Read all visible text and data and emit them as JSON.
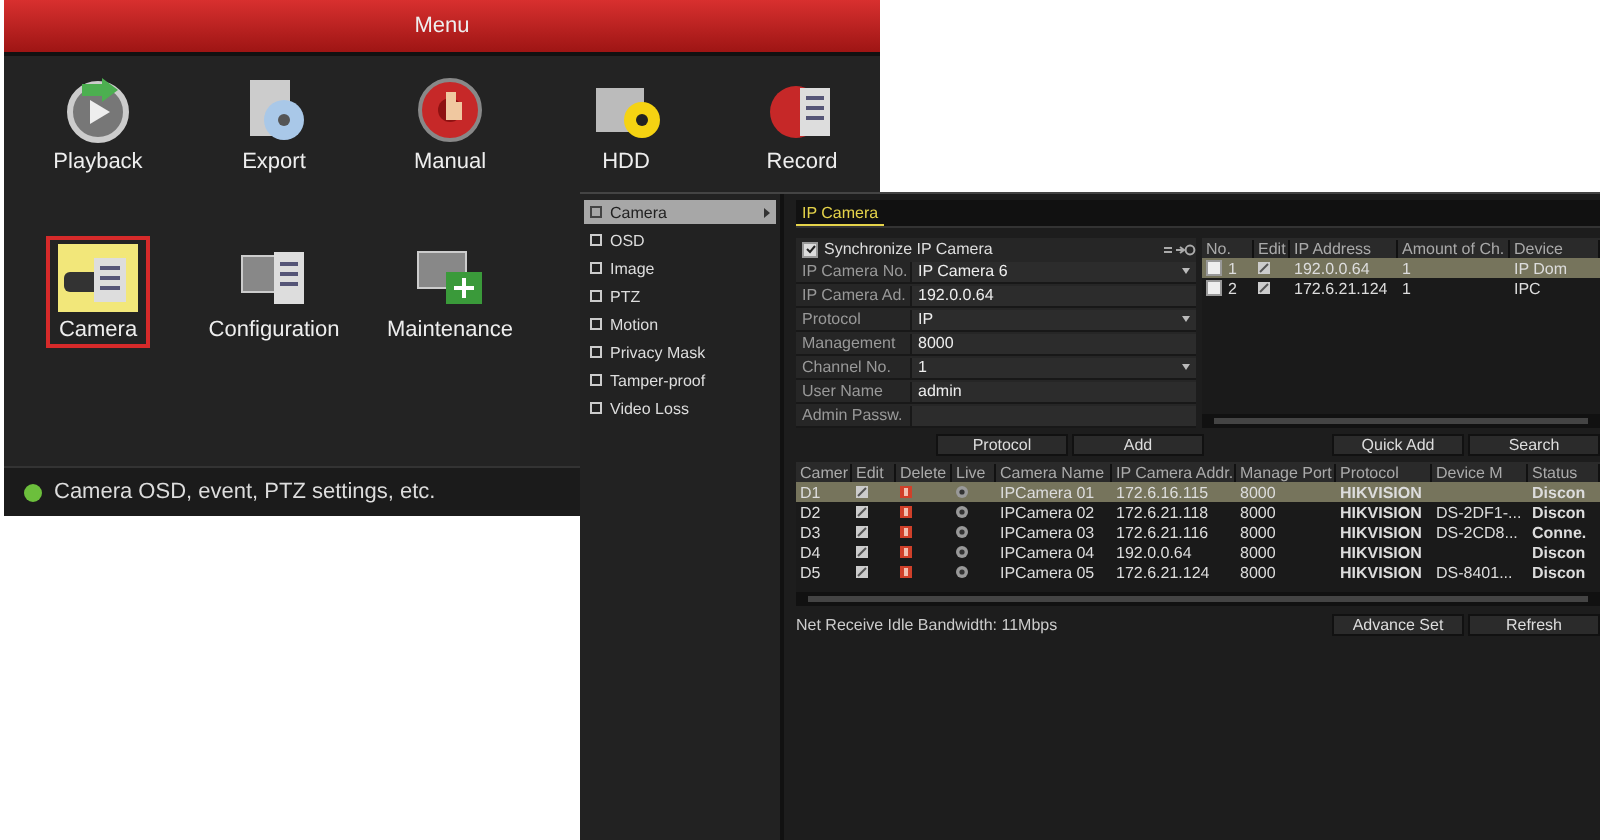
{
  "menu_window": {
    "title": "Menu",
    "tiles": [
      {
        "kind": "playback",
        "label": "Playback",
        "selected": false
      },
      {
        "kind": "export",
        "label": "Export",
        "selected": false
      },
      {
        "kind": "manual",
        "label": "Manual",
        "selected": false
      },
      {
        "kind": "hdd",
        "label": "HDD",
        "selected": false
      },
      {
        "kind": "record",
        "label": "Record",
        "selected": false
      },
      {
        "kind": "camera",
        "label": "Camera",
        "selected": true
      },
      {
        "kind": "configuration",
        "label": "Configuration",
        "selected": false
      },
      {
        "kind": "maintenance",
        "label": "Maintenance",
        "selected": false
      }
    ],
    "status_text": "Camera OSD, event, PTZ settings, etc."
  },
  "camera_window": {
    "sidebar": [
      {
        "label": "Camera",
        "selected": true,
        "has_submenu": true
      },
      {
        "label": "OSD",
        "selected": false,
        "has_submenu": false
      },
      {
        "label": "Image",
        "selected": false,
        "has_submenu": false
      },
      {
        "label": "PTZ",
        "selected": false,
        "has_submenu": false
      },
      {
        "label": "Motion",
        "selected": false,
        "has_submenu": false
      },
      {
        "label": "Privacy Mask",
        "selected": false,
        "has_submenu": false
      },
      {
        "label": "Tamper-proof",
        "selected": false,
        "has_submenu": false
      },
      {
        "label": "Video Loss",
        "selected": false,
        "has_submenu": false
      }
    ],
    "tab": "IP Camera",
    "sync": {
      "label": "Synchronize IP Camera",
      "checked": true
    },
    "fields": [
      {
        "kind": "dropdown",
        "label": "IP Camera No.",
        "value": "IP Camera 6"
      },
      {
        "kind": "text",
        "label": "IP Camera Ad.",
        "value": "192.0.0.64"
      },
      {
        "kind": "dropdown",
        "label": "Protocol",
        "value": "IP"
      },
      {
        "kind": "text",
        "label": "Management",
        "value": "8000"
      },
      {
        "kind": "dropdown",
        "label": "Channel No.",
        "value": "1"
      },
      {
        "kind": "text",
        "label": "User Name",
        "value": "admin"
      },
      {
        "kind": "text",
        "label": "Admin Passw."
      }
    ],
    "device_table": {
      "columns": [
        "No.",
        "Edit",
        "IP Address",
        "Amount of Ch.",
        "Device"
      ],
      "rows": [
        {
          "no": "1",
          "ip": "192.0.0.64",
          "amount": "1",
          "device": "IP Dom",
          "checked": false,
          "selected": true
        },
        {
          "no": "2",
          "ip": "172.6.21.124",
          "amount": "1",
          "device": "IPC",
          "checked": false,
          "selected": false
        }
      ]
    },
    "buttons_left": [
      "Protocol",
      "Add"
    ],
    "buttons_right": [
      "Quick Add",
      "Search"
    ],
    "camera_table": {
      "columns": [
        "Camer",
        "Edit",
        "Delete",
        "Live",
        "Camera Name",
        "IP Camera Addr.",
        "Manage Port",
        "Protocol",
        "Device M",
        "Status"
      ],
      "rows": [
        {
          "camera": "D1",
          "name": "IPCamera 01",
          "ip": "172.6.16.115",
          "port": "8000",
          "protocol": "HIKVISION",
          "status": "Discon",
          "selected": true
        },
        {
          "camera": "D2",
          "name": "IPCamera 02",
          "ip": "172.6.21.118",
          "port": "8000",
          "protocol": "HIKVISION",
          "device": "DS-2DF1-...",
          "status": "Discon",
          "selected": false
        },
        {
          "camera": "D3",
          "name": "IPCamera 03",
          "ip": "172.6.21.116",
          "port": "8000",
          "protocol": "HIKVISION",
          "device": "DS-2CD8...",
          "status": "Conne.",
          "selected": false
        },
        {
          "camera": "D4",
          "name": "IPCamera 04",
          "ip": "192.0.0.64",
          "port": "8000",
          "protocol": "HIKVISION",
          "status": "Discon",
          "selected": false
        },
        {
          "camera": "D5",
          "name": "IPCamera 05",
          "ip": "172.6.21.124",
          "port": "8000",
          "protocol": "HIKVISION",
          "device": "DS-8401...",
          "status": "Discon",
          "selected": false
        }
      ]
    },
    "bandwidth": "Net Receive Idle Bandwidth: 11Mbps",
    "footer_buttons": [
      "Advance Set",
      "Refresh"
    ]
  }
}
